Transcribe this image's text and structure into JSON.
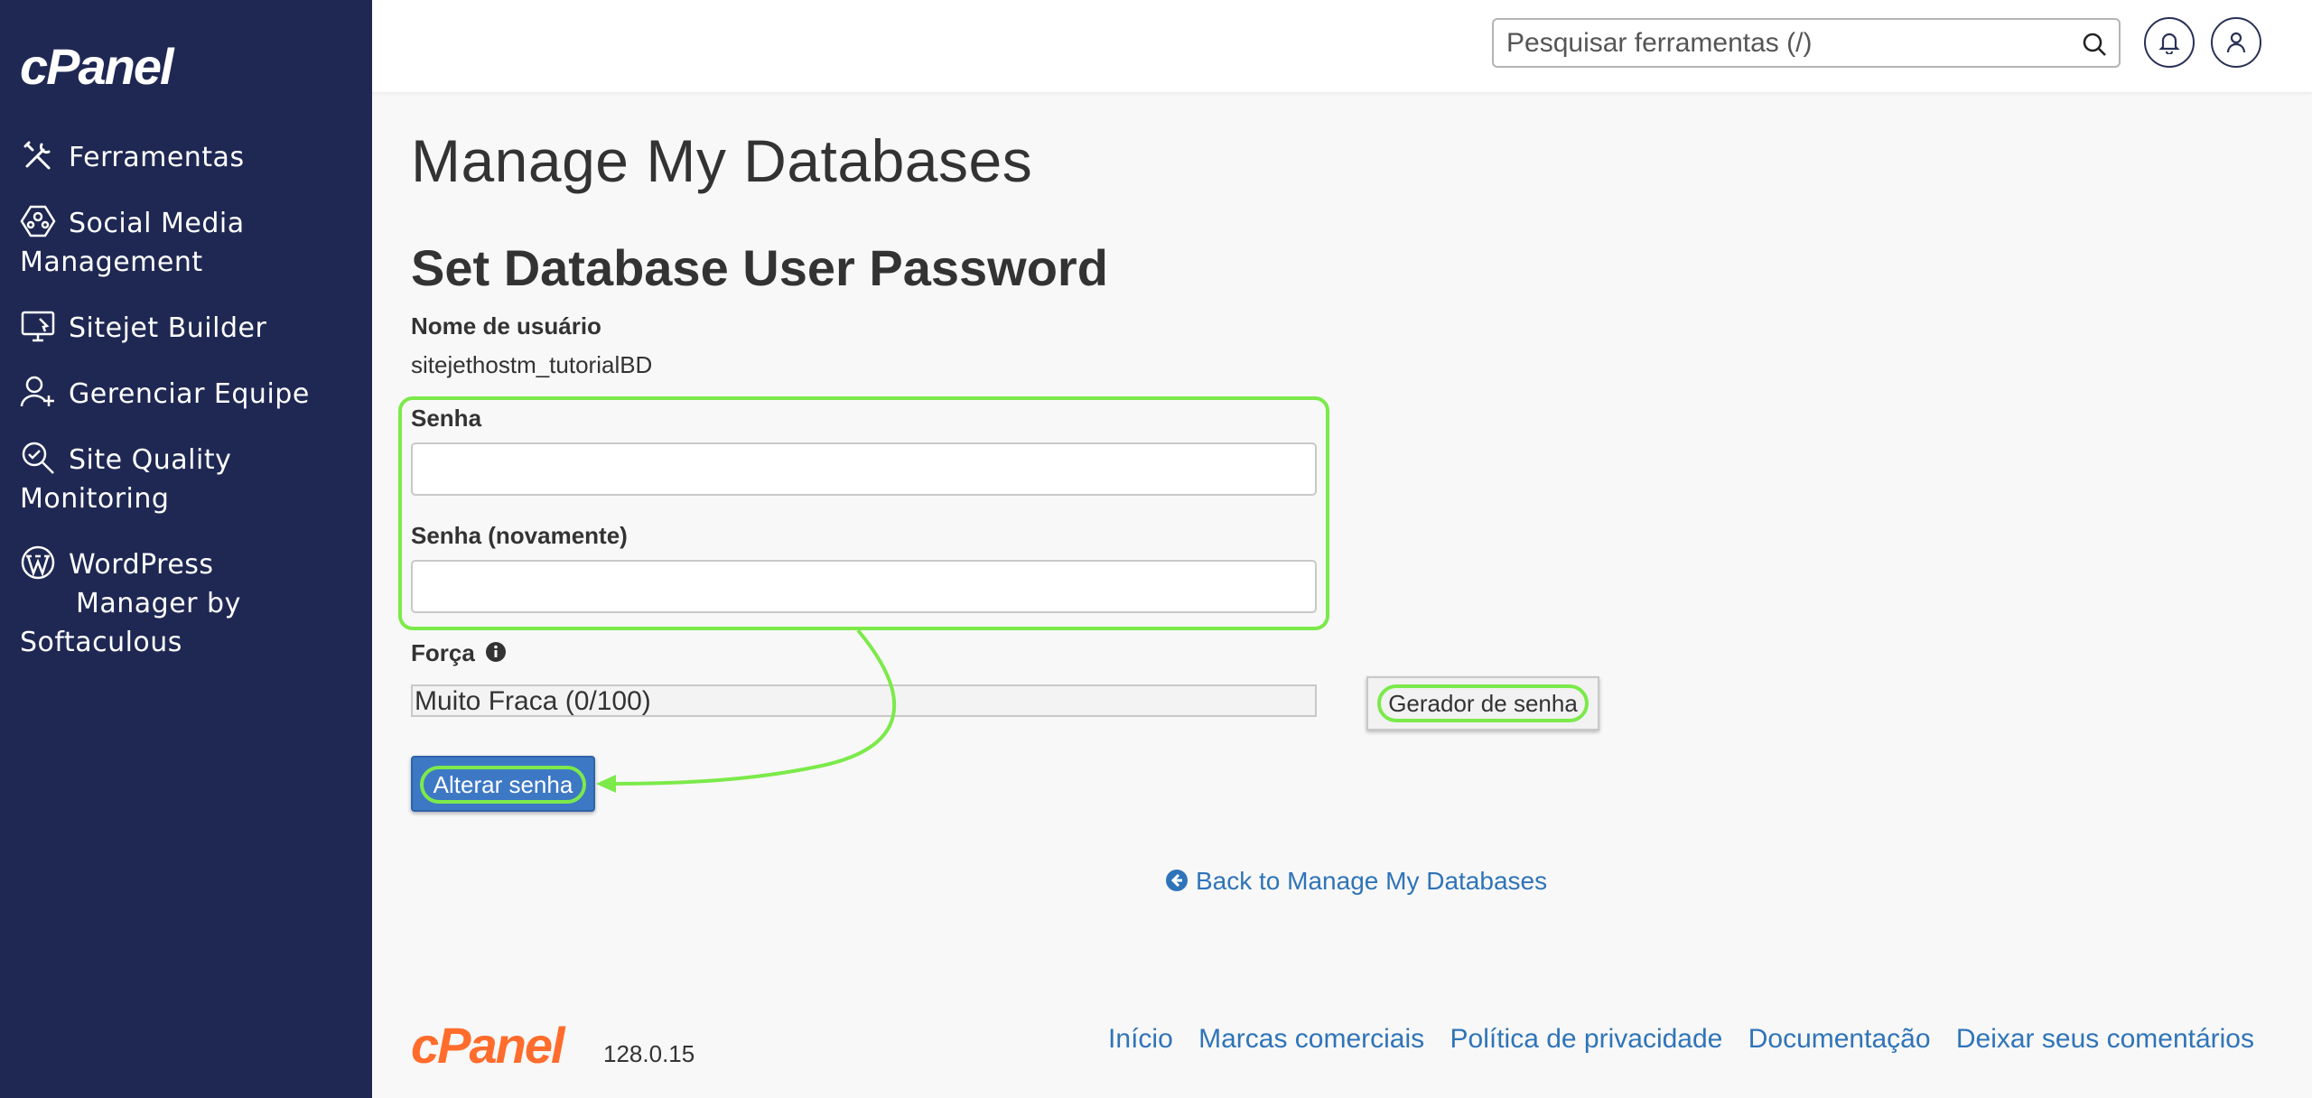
{
  "brand": {
    "logo": "cPanel",
    "version": "128.0.15"
  },
  "sidebar": {
    "items": [
      {
        "label": "Ferramentas",
        "icon": "tools-icon"
      },
      {
        "label": "Social Media",
        "label2": "Management",
        "icon": "social-media-icon"
      },
      {
        "label": "Sitejet Builder",
        "icon": "monitor-icon"
      },
      {
        "label": "Gerenciar Equipe",
        "icon": "user-plus-icon"
      },
      {
        "label": "Site Quality",
        "label2": "Monitoring",
        "icon": "magnifier-check-icon"
      },
      {
        "label": "WordPress",
        "label2": "Manager by",
        "label3": "Softaculous",
        "icon": "wordpress-icon"
      }
    ]
  },
  "header": {
    "search_placeholder": "Pesquisar ferramentas (/)"
  },
  "main": {
    "page_title": "Manage My Databases",
    "section_title": "Set Database User Password",
    "username_label": "Nome de usuário",
    "username_value": "sitejethostm_tutorialBD",
    "password_label": "Senha",
    "password_again_label": "Senha (novamente)",
    "strength_label": "Força",
    "strength_value": "Muito Fraca (0/100)",
    "strength_percent": 0,
    "generator_button": "Gerador de senha",
    "change_button": "Alterar senha",
    "back_link": "Back to Manage My Databases"
  },
  "footer": {
    "links": [
      "Início",
      "Marcas comerciais",
      "Política de privacidade",
      "Documentação",
      "Deixar seus comentários"
    ]
  },
  "colors": {
    "sidebar_bg": "#1f2853",
    "accent_blue": "#3d78c4",
    "highlight_green": "#7bea4a",
    "brand_orange": "#ff6c2c",
    "link_blue": "#2f74b8"
  }
}
